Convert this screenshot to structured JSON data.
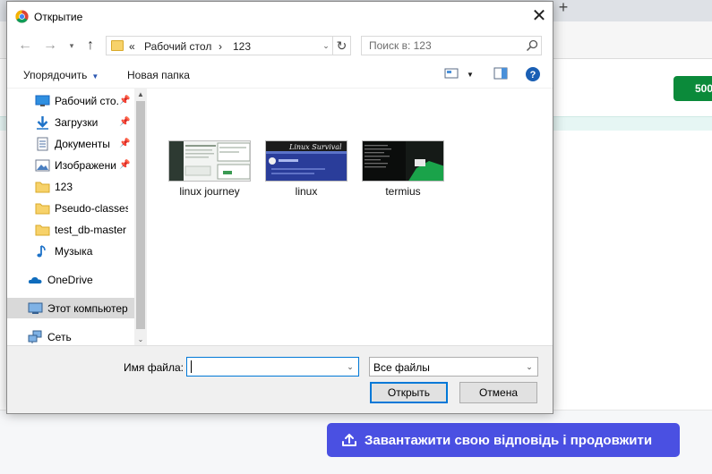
{
  "background": {
    "green_button_label": "500",
    "upload_button_label": "Завантажити свою відповідь і продовжити",
    "accent_upload": "#4a50e2",
    "accent_green": "#0b8a3a"
  },
  "dialog": {
    "title": "Открытие",
    "breadcrumb": [
      "«",
      "Рабочий стол",
      "›",
      "123"
    ],
    "search_placeholder": "Поиск в: 123",
    "toolbar": {
      "organize_label": "Упорядочить",
      "new_folder_label": "Новая папка"
    },
    "sidebar": [
      {
        "label": "Рабочий сто.",
        "icon": "desktop-icon",
        "pinned": true
      },
      {
        "label": "Загрузки",
        "icon": "download-icon",
        "pinned": true
      },
      {
        "label": "Документы",
        "icon": "document-icon",
        "pinned": true
      },
      {
        "label": "Изображени",
        "icon": "pictures-icon",
        "pinned": true
      },
      {
        "label": "123",
        "icon": "folder-icon",
        "pinned": false
      },
      {
        "label": "Pseudo-classes",
        "icon": "folder-icon",
        "pinned": false
      },
      {
        "label": "test_db-master",
        "icon": "folder-icon",
        "pinned": false
      },
      {
        "label": "Музыка",
        "icon": "music-icon",
        "pinned": false
      },
      {
        "label": "OneDrive",
        "icon": "onedrive-icon",
        "pinned": false
      },
      {
        "label": "Этот компьютер",
        "icon": "computer-icon",
        "pinned": false,
        "selected": true
      },
      {
        "label": "Сеть",
        "icon": "network-icon",
        "pinned": false
      }
    ],
    "files": [
      {
        "label": "linux journey"
      },
      {
        "label": "linux",
        "thumb_text": "Linux Survival"
      },
      {
        "label": "termius"
      }
    ],
    "filename_label": "Имя файла:",
    "filename_value": "",
    "filetype_value": "Все файлы",
    "open_button": "Открыть",
    "cancel_button": "Отмена"
  }
}
